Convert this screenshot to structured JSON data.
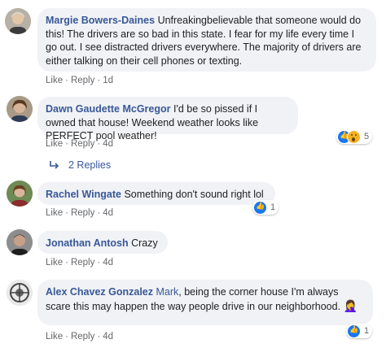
{
  "actions": {
    "like": "Like",
    "reply": "Reply",
    "sep": "·"
  },
  "comments": [
    {
      "author": "Margie Bowers-Daines",
      "text": "Unfreakingbelievable that someone would do this! The drivers are so bad in this state. I fear for my life every time I go out. I see distracted drivers everywhere. The majority of drivers are either talking on their cell phones or texting.",
      "time": "1d"
    },
    {
      "author": "Dawn Gaudette McGregor",
      "text": "I'd be so pissed if I owned that house! Weekend weather looks like PERFECT pool weather!",
      "time": "4d",
      "reactions": {
        "types": [
          "like-icon",
          "wow-icon"
        ],
        "count": "5"
      }
    },
    {
      "author": "Rachel Wingate",
      "text": "Something don't sound right lol",
      "time": "4d",
      "reactions": {
        "types": [
          "like-icon"
        ],
        "count": "1"
      }
    },
    {
      "author": "Jonathan Antosh",
      "text": "Crazy",
      "time": "4d"
    },
    {
      "author": "Alex Chavez Gonzalez",
      "mention": "Mark",
      "text": ", being the corner house I'm always scare this may happen the way people drive in our neighborhood.",
      "emoji": "🤦‍♀️",
      "time": "4d",
      "reactions": {
        "types": [
          "like-icon"
        ],
        "count": "1"
      }
    }
  ],
  "replies_link": "2 Replies",
  "colors": {
    "link": "#385898",
    "bubble": "#f0f2f5",
    "meta": "#65676b",
    "like": "#1877f2",
    "wow": "#f7b125"
  }
}
